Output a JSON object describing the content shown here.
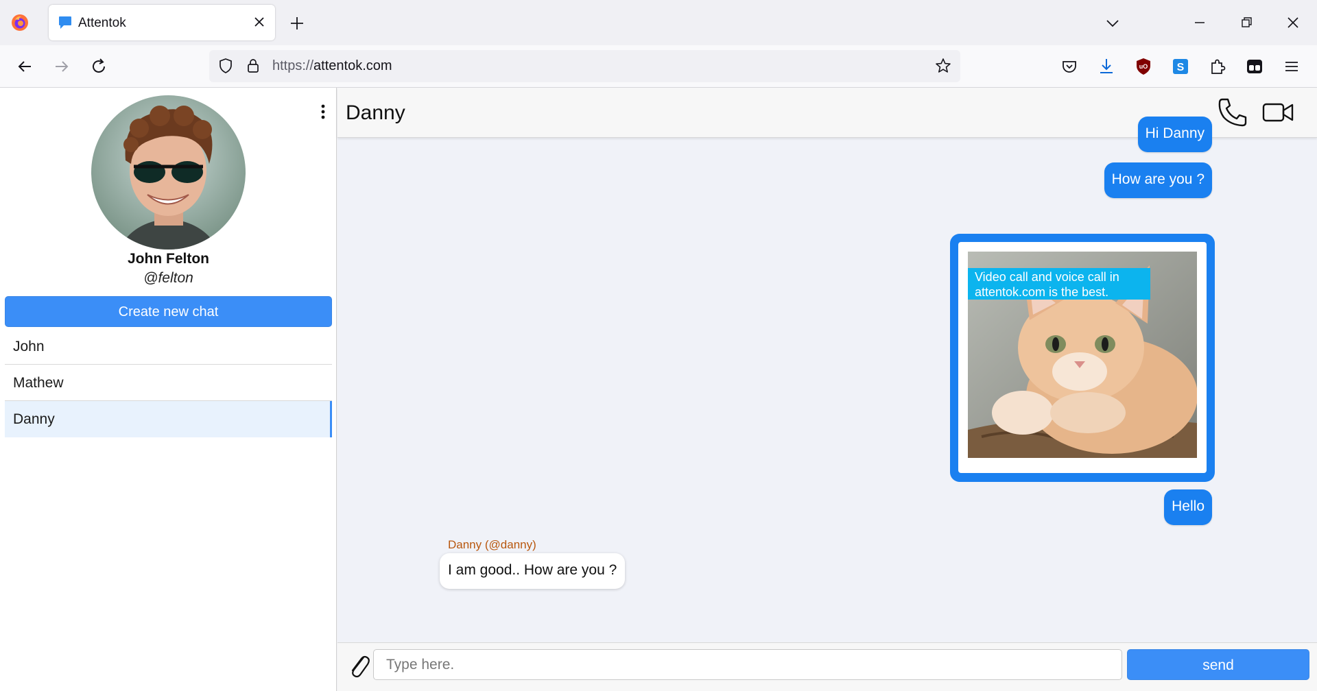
{
  "browser": {
    "tab_title": "Attentok",
    "url_protocol": "https://",
    "url_host": "attentok.com"
  },
  "profile": {
    "name": "John Felton",
    "handle": "@felton"
  },
  "sidebar": {
    "create_label": "Create new chat",
    "chats": [
      {
        "label": "John"
      },
      {
        "label": "Mathew"
      },
      {
        "label": "Danny"
      }
    ]
  },
  "chat": {
    "title": "Danny",
    "messages": {
      "m1": "Hi Danny",
      "m2": "How are you ?",
      "image_caption": "Video call and voice call in attentok.com is the best.",
      "m4": "Hello",
      "incoming_sender": "Danny (@danny)",
      "incoming_text": "I am good.. How are you ?"
    },
    "composer": {
      "placeholder": "Type here.",
      "send_label": "send"
    }
  },
  "colors": {
    "accent": "#3b8ef7",
    "outgoing_bubble": "#1a80f0",
    "sender_label": "#b8570e"
  }
}
